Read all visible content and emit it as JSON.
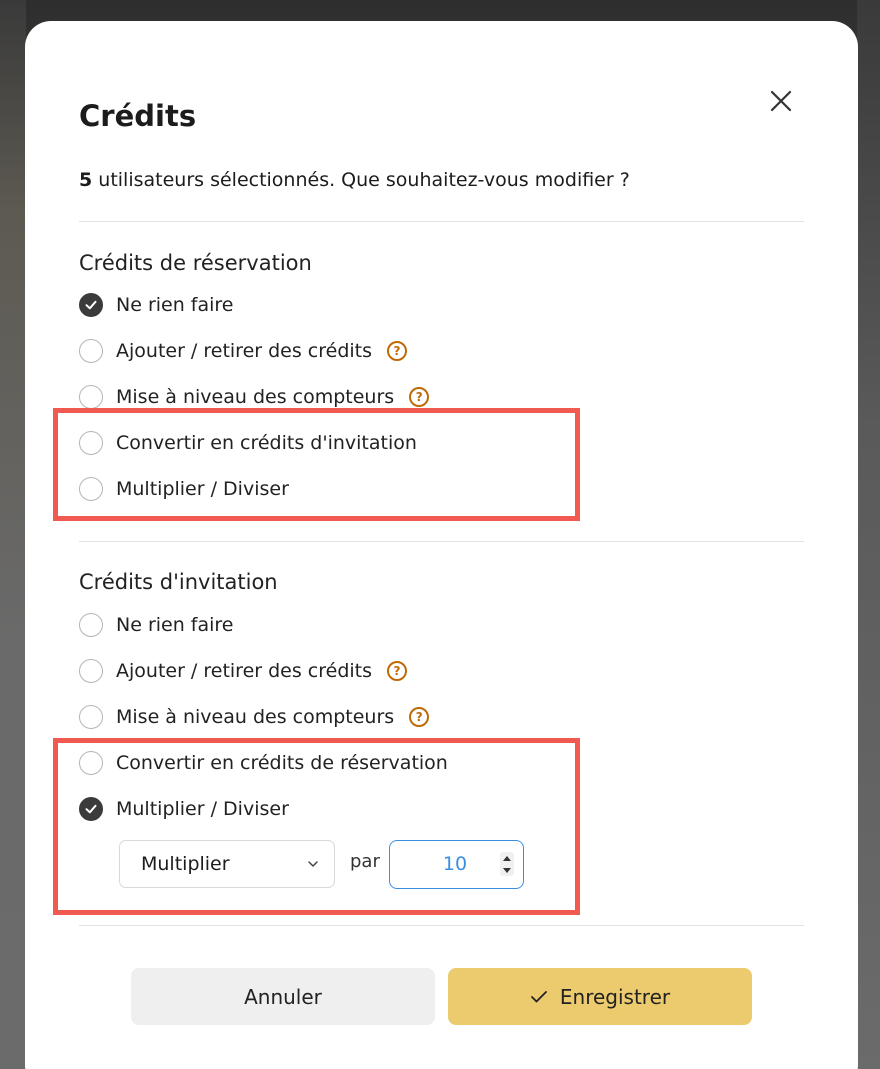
{
  "modal": {
    "title": "Crédits",
    "intro_count": "5",
    "intro_text": " utilisateurs sélectionnés. Que souhaitez-vous modifier ?"
  },
  "reservation": {
    "title": "Crédits de réservation",
    "options": [
      {
        "label": "Ne rien faire",
        "checked": true,
        "help": false
      },
      {
        "label": "Ajouter / retirer des crédits",
        "checked": false,
        "help": true
      },
      {
        "label": "Mise à niveau des compteurs",
        "checked": false,
        "help": true
      },
      {
        "label": "Convertir en crédits d'invitation",
        "checked": false,
        "help": false
      },
      {
        "label": "Multiplier / Diviser",
        "checked": false,
        "help": false
      }
    ]
  },
  "invitation": {
    "title": "Crédits d'invitation",
    "options": [
      {
        "label": "Ne rien faire",
        "checked": false,
        "help": false
      },
      {
        "label": "Ajouter / retirer des crédits",
        "checked": false,
        "help": true
      },
      {
        "label": "Mise à niveau des compteurs",
        "checked": false,
        "help": true
      },
      {
        "label": "Convertir en crédits de réservation",
        "checked": false,
        "help": false
      },
      {
        "label": "Multiplier / Diviser",
        "checked": true,
        "help": false
      }
    ],
    "operation": {
      "selected": "Multiplier",
      "par_label": "par",
      "value": "10"
    }
  },
  "icons": {
    "help": "?"
  },
  "buttons": {
    "cancel": "Annuler",
    "save": "Enregistrer"
  },
  "colors": {
    "highlight": "#f05a50",
    "save_button": "#ebcb6e",
    "help_icon": "#c06a06",
    "focus": "#3b8fe0"
  }
}
